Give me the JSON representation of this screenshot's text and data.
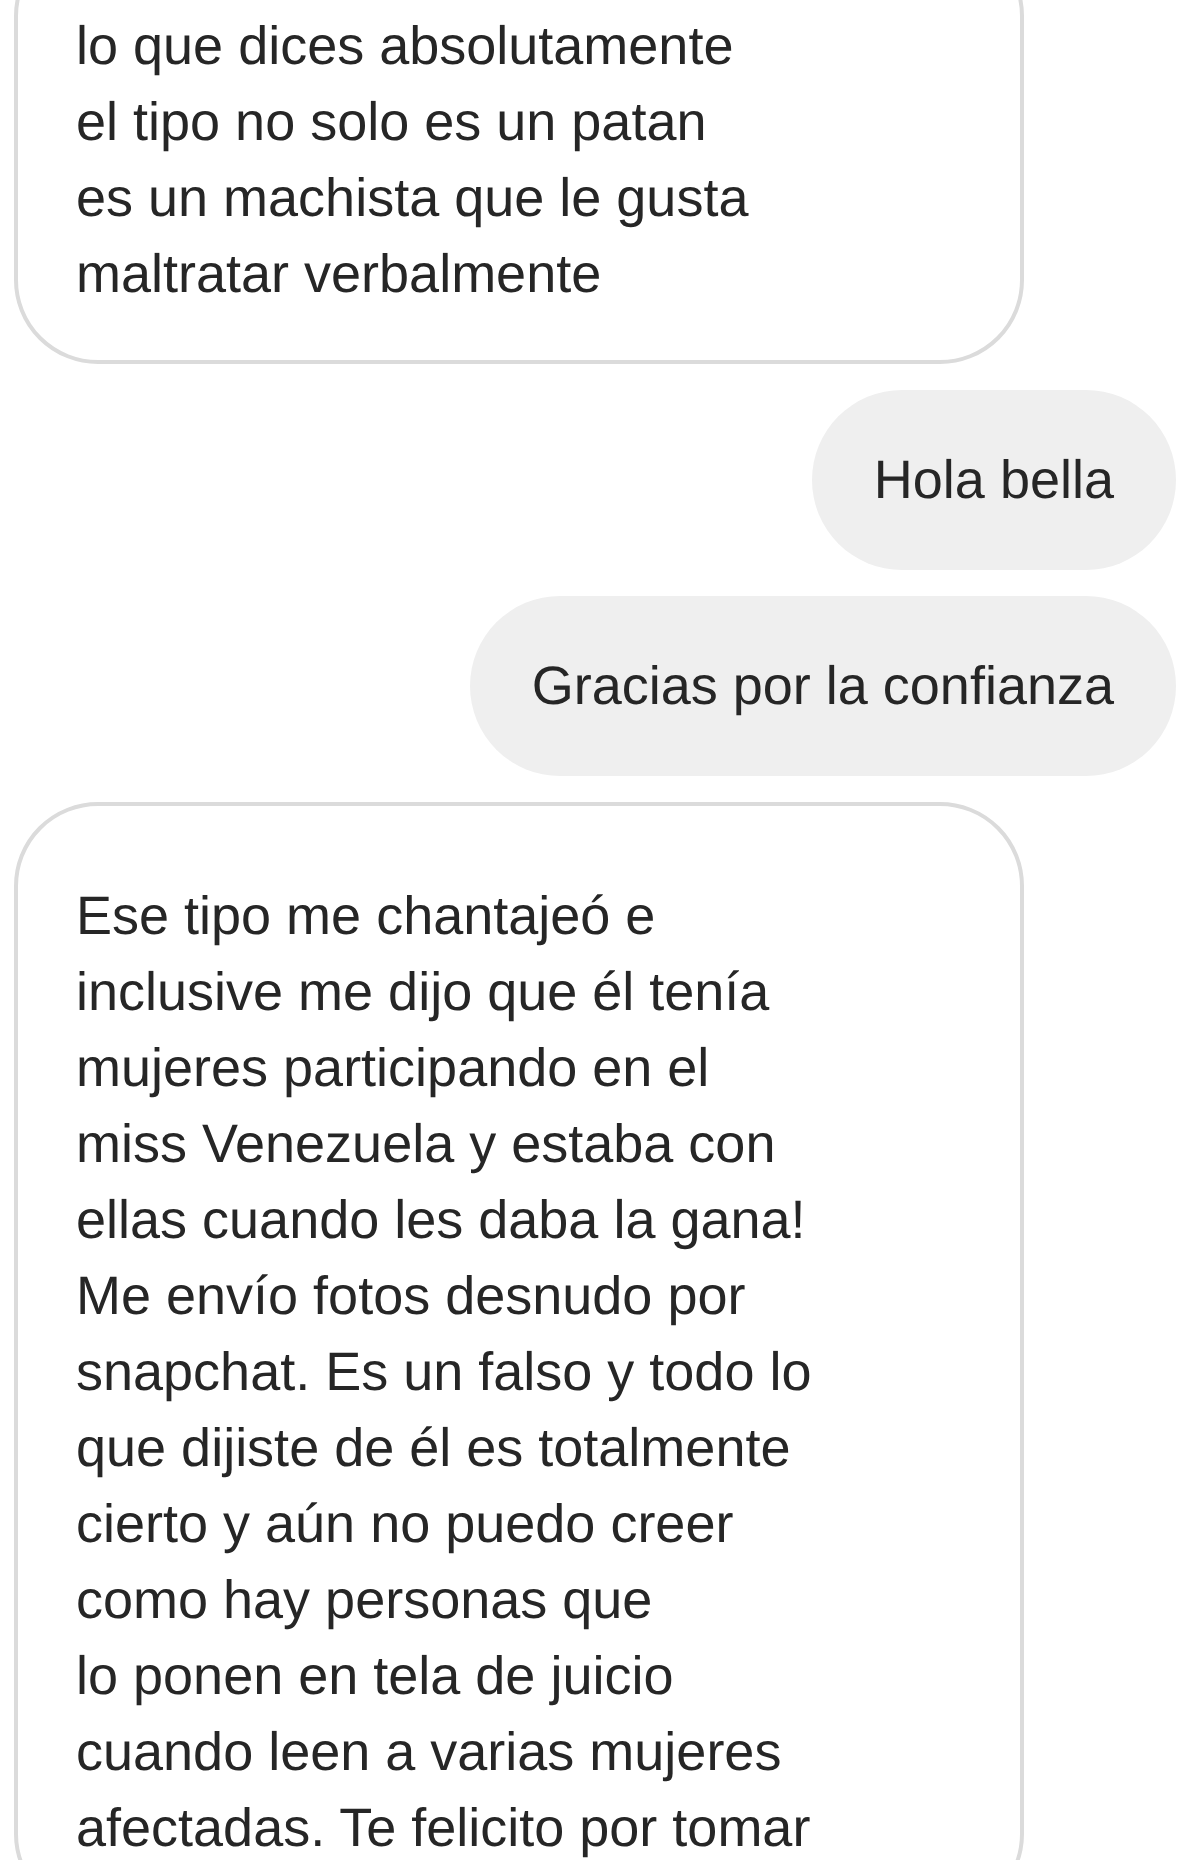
{
  "messages": [
    {
      "kind": "received",
      "text": "lo que dices absolutamente\nel tipo no solo es un patan\nes un machista que le gusta\nmaltratar verbalmente"
    },
    {
      "kind": "sent",
      "text": "Hola bella"
    },
    {
      "kind": "sent",
      "text": "Gracias por la confianza"
    },
    {
      "kind": "received",
      "text": "Ese tipo me chantajeó e\ninclusive me dijo que él tenía\nmujeres participando en el\nmiss Venezuela y estaba con\nellas cuando les daba la gana!\nMe envío fotos desnudo por\nsnapchat. Es un falso y todo lo\nque dijiste de él es totalmente\ncierto y aún no puedo creer\ncomo hay personas que\nlo ponen en tela de juicio\ncuando leen a varias mujeres\nafectadas. Te felicito por tomar"
    }
  ]
}
